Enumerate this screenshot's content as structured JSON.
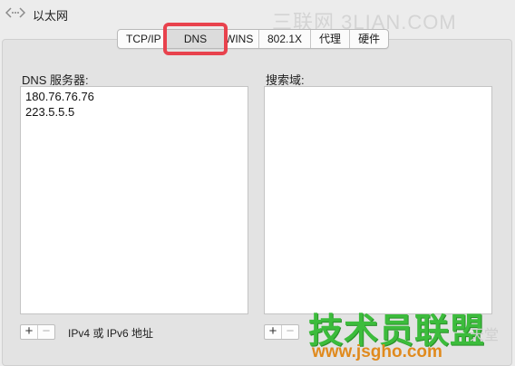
{
  "window": {
    "title": "以太网",
    "watermark_top": "三联网 3LIAN.COM"
  },
  "tabs": [
    {
      "label": "TCP/IP",
      "active": false
    },
    {
      "label": "DNS",
      "active": true
    },
    {
      "label": "WINS",
      "active": false
    },
    {
      "label": "802.1X",
      "active": false
    },
    {
      "label": "代理",
      "active": false
    },
    {
      "label": "硬件",
      "active": false
    }
  ],
  "dns": {
    "label": "DNS 服务器:",
    "servers": [
      "180.76.76.76",
      "223.5.5.5"
    ],
    "add_label": "+",
    "remove_label": "−",
    "note": "IPv4 或 IPv6 地址"
  },
  "search": {
    "label": "搜索域:",
    "domains": [],
    "add_label": "+",
    "remove_label": "−"
  },
  "watermark_bottom": {
    "title": "技术员联盟",
    "url": "www.jsgho.com",
    "light_text": "天堂"
  },
  "colors": {
    "highlight": "#e8424d",
    "watermark_green": "#3cbc3c",
    "watermark_orange": "#e08a1e"
  }
}
